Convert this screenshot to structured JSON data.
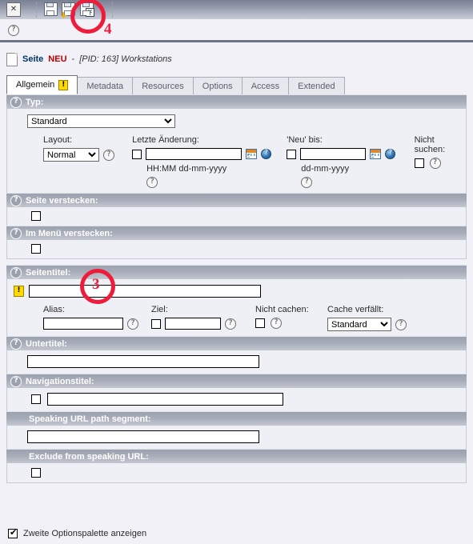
{
  "toolbar": {
    "close_label": "✕",
    "close_name": "Close",
    "save_label": "Save",
    "save_view_label": "Save and view",
    "save_close_label": "Save and close",
    "help_label": "?"
  },
  "record": {
    "type_label": "Seite",
    "new_label": "NEU",
    "separator": "-",
    "pid_text": "[PID: 163] Workstations"
  },
  "tabs": [
    {
      "label": "Allgemein",
      "badge": "!",
      "active": true
    },
    {
      "label": "Metadata",
      "badge": "",
      "active": false
    },
    {
      "label": "Resources",
      "badge": "",
      "active": false
    },
    {
      "label": "Options",
      "badge": "",
      "active": false
    },
    {
      "label": "Access",
      "badge": "",
      "active": false
    },
    {
      "label": "Extended",
      "badge": "",
      "active": false
    }
  ],
  "sections": {
    "typ": {
      "header": "Typ:",
      "type_select_value": "Standard",
      "layout_label": "Layout:",
      "layout_value": "Normal",
      "lastchange_label": "Letzte Änderung:",
      "lastchange_value": "",
      "lastchange_hint": "HH:MM dd-mm-yyyy",
      "newuntil_label": "'Neu' bis:",
      "newuntil_value": "",
      "newuntil_hint": "dd-mm-yyyy",
      "nosearch_label": "Nicht suchen:"
    },
    "hide_page": {
      "header": "Seite verstecken:"
    },
    "hide_menu": {
      "header": "Im Menü verstecken:"
    },
    "title": {
      "header": "Seitentitel:",
      "value": "",
      "alias_label": "Alias:",
      "alias_value": "",
      "target_label": "Ziel:",
      "target_value": "",
      "nocache_label": "Nicht cachen:",
      "cache_expires_label": "Cache verfällt:",
      "cache_expires_value": "Standard"
    },
    "subtitle": {
      "header": "Untertitel:",
      "value": ""
    },
    "navtitle": {
      "header": "Navigationstitel:",
      "value": ""
    },
    "speaking_url": {
      "header": "Speaking URL path segment:",
      "value": ""
    },
    "exclude_url": {
      "header": "Exclude from speaking URL:"
    }
  },
  "footer": {
    "second_palette_label": "Zweite Optionspalette anzeigen"
  },
  "annotations": [
    {
      "number": "4"
    },
    {
      "number": "3"
    }
  ],
  "colors": {
    "accent_red": "#ee1c3a",
    "title_blue": "#00366b",
    "new_red": "#c00000",
    "header_gray": "#9ba1ae"
  }
}
